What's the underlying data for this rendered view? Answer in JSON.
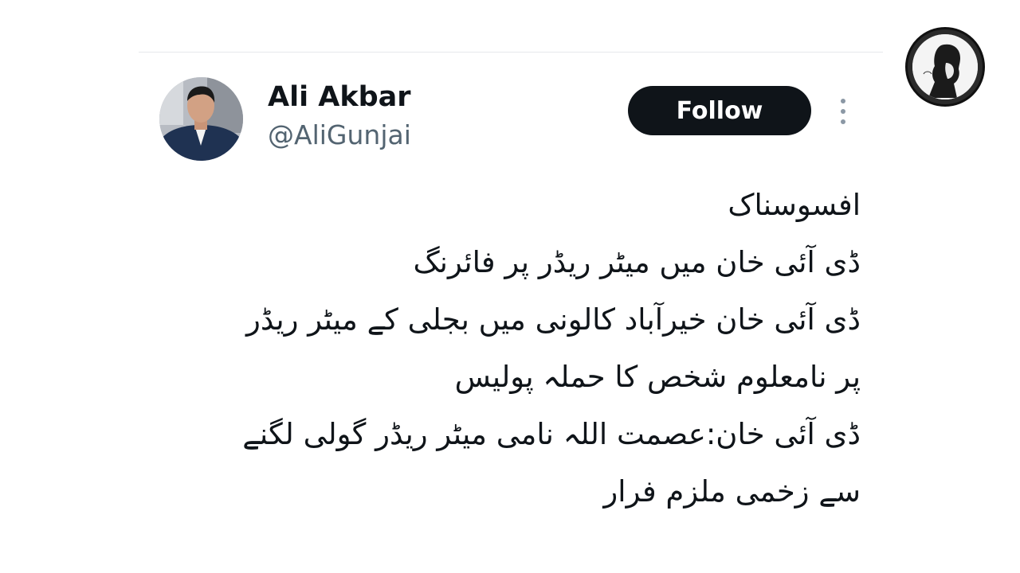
{
  "author": {
    "display_name": "Ali Akbar",
    "handle": "@AliGunjai"
  },
  "actions": {
    "follow_label": "Follow"
  },
  "tweet": {
    "lines": [
      "افسوسناک",
      "ڈی آئی خان میں میٹر ریڈر پر فائرنگ",
      "ڈی آئی خان خیرآباد کالونی میں بجلی کے میٹر ریڈر",
      "پر نامعلوم شخص کا حملہ پولیس",
      "ڈی آئی خان:عصمت اللہ نامی میٹر ریڈر گولی لگنے",
      "سے زخمی ملزم فرار"
    ]
  },
  "icons": {
    "more": "more-vertical-icon",
    "channel_logo": "channel-logo-icon"
  },
  "colors": {
    "follow_bg": "#0f1419",
    "handle_text": "#536471",
    "divider": "#e6e9ec"
  }
}
